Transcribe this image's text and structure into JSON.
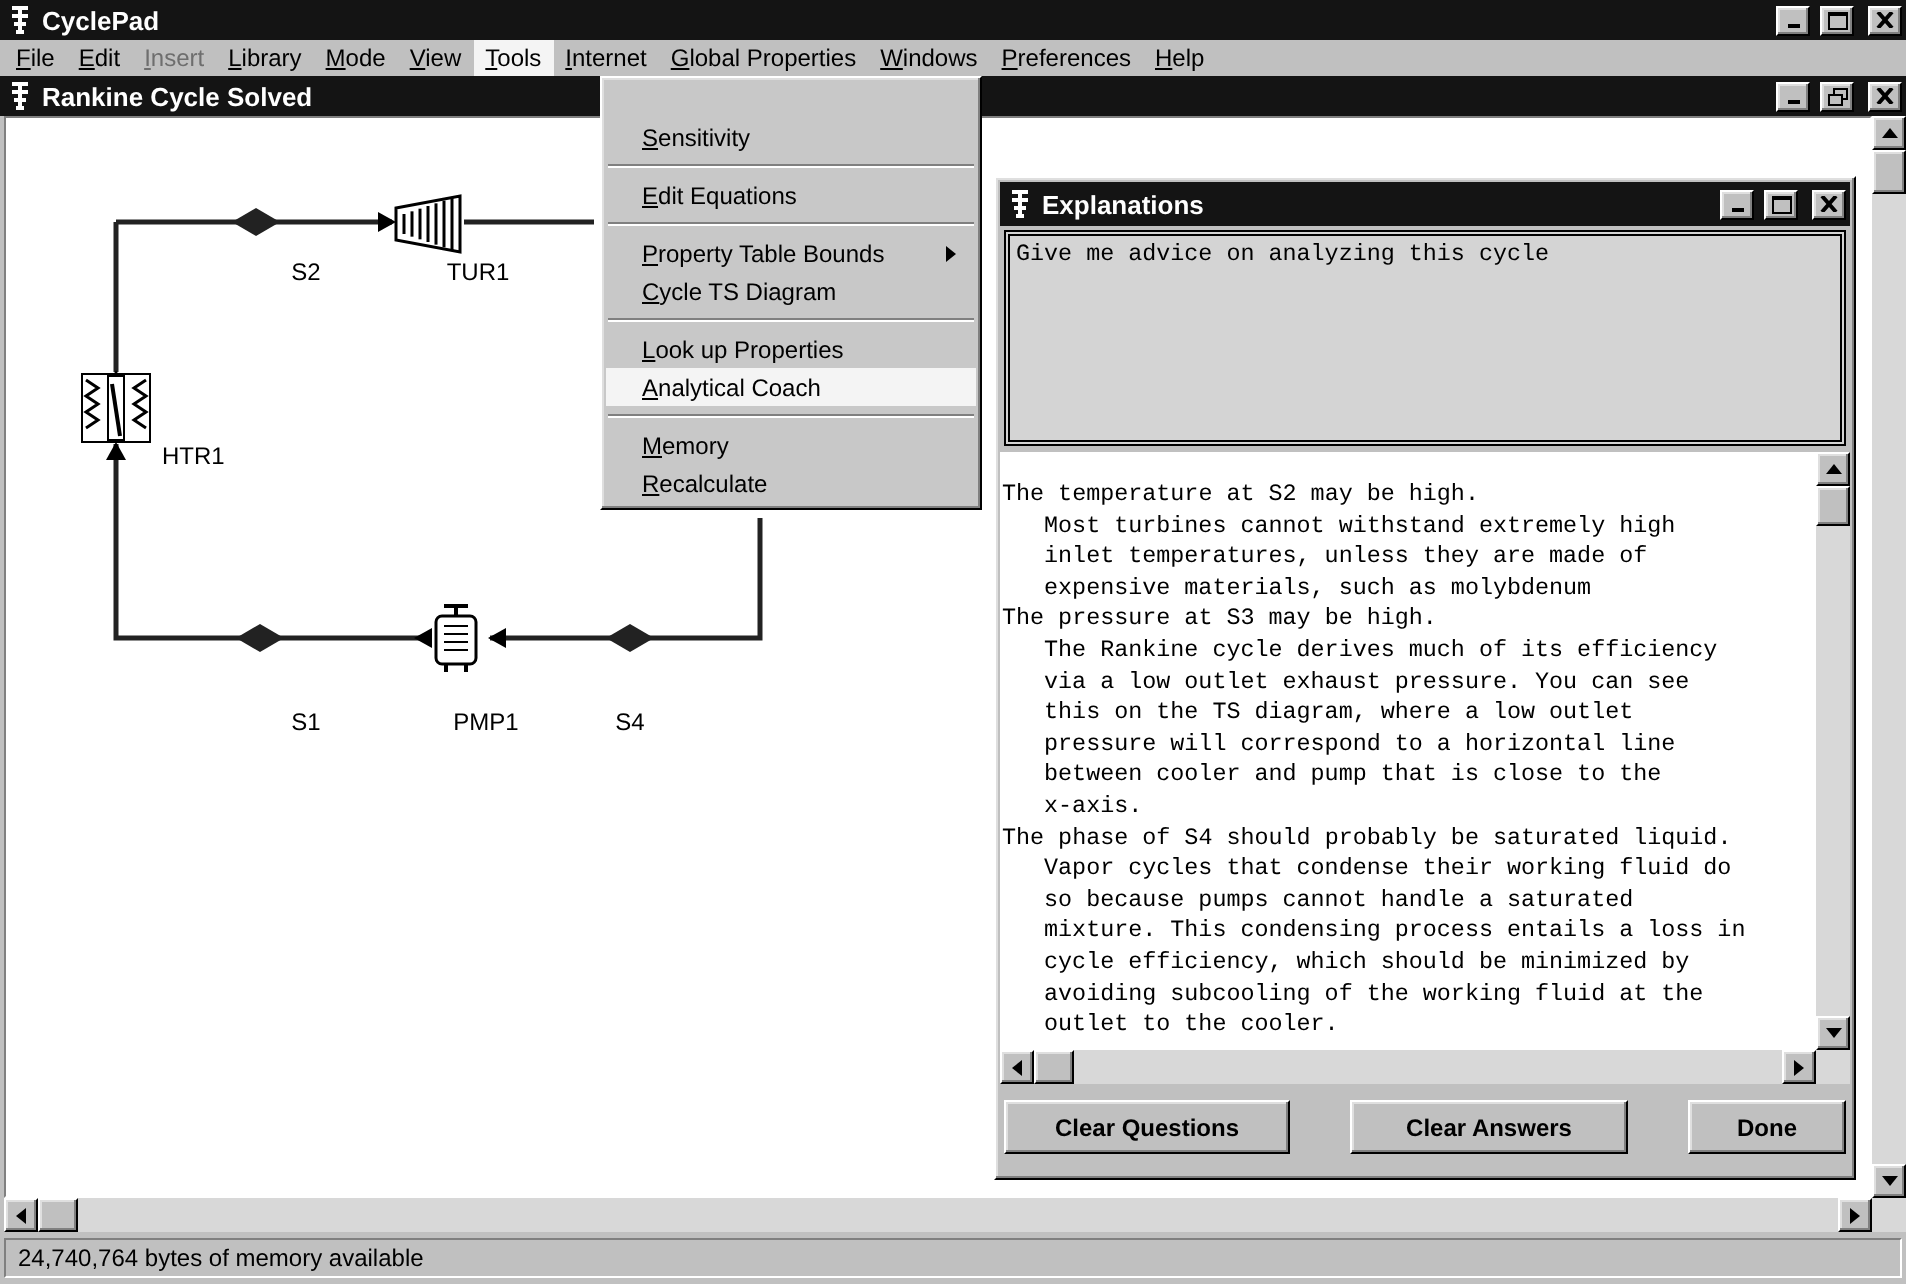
{
  "window": {
    "title": "CyclePad"
  },
  "menu": [
    {
      "label": "File",
      "selected": false,
      "disabled": false
    },
    {
      "label": "Edit",
      "selected": false,
      "disabled": false
    },
    {
      "label": "Insert",
      "selected": false,
      "disabled": true
    },
    {
      "label": "Library",
      "selected": false,
      "disabled": false
    },
    {
      "label": "Mode",
      "selected": false,
      "disabled": false
    },
    {
      "label": "View",
      "selected": false,
      "disabled": false
    },
    {
      "label": "Tools",
      "selected": true,
      "disabled": false
    },
    {
      "label": "Internet",
      "selected": false,
      "disabled": false
    },
    {
      "label": "Global Properties",
      "selected": false,
      "disabled": false
    },
    {
      "label": "Windows",
      "selected": false,
      "disabled": false
    },
    {
      "label": "Preferences",
      "selected": false,
      "disabled": false
    },
    {
      "label": "Help",
      "selected": false,
      "disabled": false
    }
  ],
  "tools_menu": [
    {
      "kind": "item",
      "label": "Sensitivity",
      "selected": false
    },
    {
      "kind": "separator"
    },
    {
      "kind": "item",
      "label": "Edit Equations",
      "selected": false
    },
    {
      "kind": "separator"
    },
    {
      "kind": "submenu",
      "label": "Property Table Bounds",
      "selected": false
    },
    {
      "kind": "item",
      "label": "Cycle TS Diagram",
      "selected": false
    },
    {
      "kind": "separator"
    },
    {
      "kind": "item",
      "label": "Look up Properties",
      "selected": false
    },
    {
      "kind": "item",
      "label": "Analytical Coach",
      "selected": true
    },
    {
      "kind": "separator"
    },
    {
      "kind": "item",
      "label": "Memory",
      "selected": false
    },
    {
      "kind": "item",
      "label": "Recalculate",
      "selected": false
    }
  ],
  "document": {
    "title": "Rankine Cycle Solved",
    "diagram": [
      {
        "kind": "stream",
        "label": "S2"
      },
      {
        "kind": "turbine",
        "label": "TUR1"
      },
      {
        "kind": "heater",
        "label": "HTR1"
      },
      {
        "kind": "stream",
        "label": "S1"
      },
      {
        "kind": "pump",
        "label": "PMP1"
      },
      {
        "kind": "stream",
        "label": "S4"
      }
    ]
  },
  "explanations": {
    "title": "Explanations",
    "question": "Give me advice on analyzing this cycle",
    "answers": [
      {
        "heading": "The temperature at S2 may be high.",
        "lines": [
          "Most turbines cannot withstand extremely high",
          "inlet temperatures, unless they are made of",
          "expensive materials, such as molybdenum"
        ]
      },
      {
        "heading": "The pressure at S3 may be high.",
        "lines": [
          "The Rankine cycle derives much of its efficiency",
          "via a low outlet exhaust pressure. You can see",
          "this on the TS diagram, where a low outlet",
          "pressure will correspond to a horizontal line",
          "between cooler and pump that is close to the",
          "x-axis."
        ]
      },
      {
        "heading": "The phase of S4 should probably be saturated liquid.",
        "lines": [
          "Vapor cycles that condense their working fluid do",
          "so because pumps cannot handle a saturated",
          "mixture. This condensing process entails a loss in",
          "cycle efficiency, which should be minimized by",
          "avoiding subcooling of the working fluid at the",
          "outlet to the cooler."
        ]
      }
    ],
    "buttons": [
      "Clear Questions",
      "Clear Answers",
      "Done"
    ]
  },
  "status_bar": "24,740,764 bytes of memory available"
}
